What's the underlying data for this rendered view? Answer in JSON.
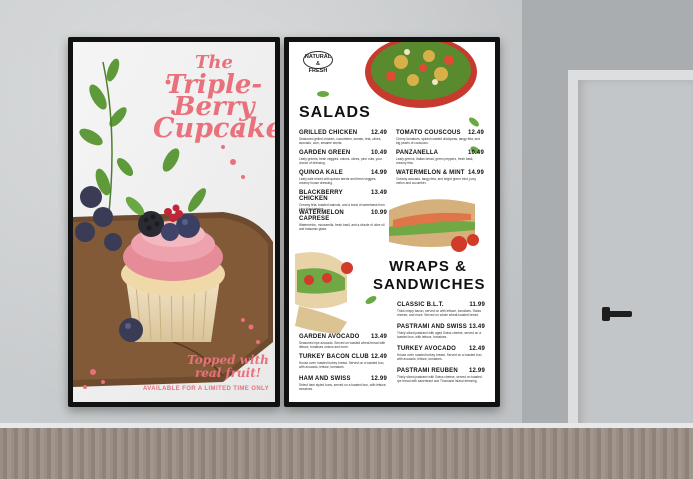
{
  "left_panel": {
    "title_lines": [
      "The",
      "Triple-",
      "Berry",
      "Cupcake"
    ],
    "subtitle_lines": [
      "Topped with",
      "real fruit!"
    ],
    "footer": "AVAILABLE FOR A LIMITED TIME ONLY",
    "colors": {
      "accent": "#e8717c",
      "frosting": "#e58c98",
      "board": "#6e4a2e"
    }
  },
  "right_panel": {
    "brand": {
      "line1": "NATURAL",
      "line2": "&",
      "line3": "FRESH"
    },
    "salads_heading": "SALADS",
    "wraps_heading_line1": "WRAPS &",
    "wraps_heading_line2": "SANDWICHES",
    "salads_left": [
      {
        "name": "GRILLED CHICKEN",
        "price": "12.49",
        "desc": "Seasoned grilled chicken, cucumbers, tomato, feta, olives, avocado, corn, sesame seeds."
      },
      {
        "name": "GARDEN GREEN",
        "price": "10.49",
        "desc": "Leafy greens, fresh veggies, onions, olives, pine nuts, your choice of dressing."
      },
      {
        "name": "QUINOA KALE",
        "price": "14.99",
        "desc": "Leafy kale mixed with quinoa seeds and fresh veggies, creamy house dressing."
      },
      {
        "name": "BLACKBERRY CHICKEN",
        "price": "13.49",
        "desc": "Creamy feta, toasted walnuts, and a burst of sweetness from juicy blackberries."
      },
      {
        "name": "WATERMELON CAPRESE",
        "price": "10.99",
        "desc": "Watermelon, mozzarella, fresh basil, and a drizzle of olive oil and balsamic glaze."
      }
    ],
    "salads_right": [
      {
        "name": "TOMATO COUSCOUS",
        "price": "12.49",
        "desc": "Cherry tomatoes, spiced roasted chickpeas, tangy feta, and big pearls of couscous."
      },
      {
        "name": "PANZANELLA",
        "price": "10.49",
        "desc": "Leafy greens, Italian bread, green peppers, fresh basil, creamy feta."
      },
      {
        "name": "WATERMELON & MINT",
        "price": "14.99",
        "desc": "Creamy avocado, tangy feta, and bright green mint, juicy melon and cucumber."
      }
    ],
    "wraps_left": [
      {
        "name": "GARDEN AVOCADO",
        "price": "13.49",
        "desc": "Seasoned ripe avocado. Served on toasted wheat bread with lettuce, tomatoes onions and more."
      },
      {
        "name": "TURKEY BACON CLUB",
        "price": "12.49",
        "desc": "House oven roasted turkey breast. Served on a toasted bun, with avocado, lettuce, tomatoes."
      },
      {
        "name": "HAM AND SWISS",
        "price": "12.99",
        "desc": "Select ham styled buns, served on a toasted bun, with lettuce, tomatoes."
      }
    ],
    "wraps_right": [
      {
        "name": "CLASSIC B.L.T.",
        "price": "11.99",
        "desc": "Thick crispy bacon, served on with lettuce, tomatoes. Swiss cheese, and more. Served on whole wheat toasted bread."
      },
      {
        "name": "PASTRAMI AND SWISS",
        "price": "13.49",
        "desc": "Thinly sliced pastrami with aged Swiss cheese, served on a toasted bun, with lettuce, tomatoes."
      },
      {
        "name": "TURKEY AVOCADO",
        "price": "12.49",
        "desc": "House oven roasted turkey breast. Served on a toasted bun, with avocado, lettuce, tomatoes."
      },
      {
        "name": "PASTRAMI REUBEN",
        "price": "12.99",
        "desc": "Thinly sliced pastrami with Swiss cheese, served on toasted rye bread with sauerkraut and Thousand Island dressing."
      }
    ]
  }
}
